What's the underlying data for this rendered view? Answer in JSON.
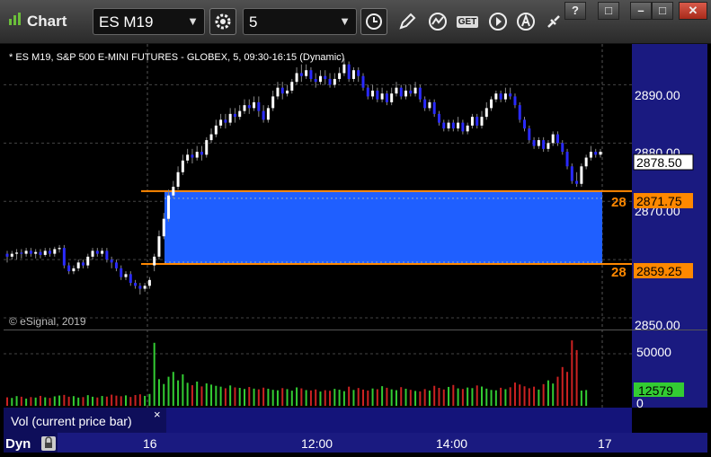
{
  "window": {
    "title": "Chart",
    "help_label": "?",
    "restore_label": "□",
    "minimize_label": "–",
    "maximize_label": "□",
    "close_label": "✕"
  },
  "toolbar": {
    "symbol": "ES M19",
    "interval": "5",
    "get_label": "GET",
    "icons": [
      "settings-gear-icon",
      "clock-icon",
      "pencil-draw-icon",
      "study-chart-icon",
      "get-data-icon",
      "play-icon",
      "alert-a-icon",
      "link-icon"
    ]
  },
  "chart": {
    "header": "* ES M19, S&P 500 E-MINI FUTURES - GLOBEX, 5, 09:30-16:15 (Dynamic)",
    "copyright": "© eSignal, 2019",
    "price_ticks": [
      "2890.00",
      "2880.00",
      "2870.00",
      "2860.00",
      "2850.00"
    ],
    "last_price_label": "2878.50",
    "upper_band_label": "2871.75",
    "lower_band_label": "2859.25",
    "upper_band_text": "28",
    "lower_band_text": "28",
    "volume_ticks": [
      "50000",
      "0"
    ],
    "volume_value_label": "12579",
    "volume_panel_title": "Vol (current price bar)",
    "volume_close": "×",
    "time_ticks": [
      "16",
      "12:00",
      "14:00",
      "17"
    ],
    "dyn_label": "Dyn",
    "colors": {
      "up_candle": "#ffffff",
      "down_candle": "#2a2aff",
      "band_fill": "#1f5fff",
      "band_line": "#ff8800",
      "axis_bg": "#1a1a80",
      "vol_up": "#33cc33",
      "vol_down": "#cc2222"
    }
  },
  "chart_data": {
    "type": "candlestick",
    "ylim": [
      2848,
      2897
    ],
    "band": {
      "upper": 2871.75,
      "lower": 2859.25
    },
    "last": 2878.5,
    "candles": [
      [
        2861.0,
        2860.5,
        2859.5,
        2861.5
      ],
      [
        2860.5,
        2861.0,
        2860.0,
        2861.5
      ],
      [
        2861.0,
        2861.2,
        2860.0,
        2861.8
      ],
      [
        2861.2,
        2861.0,
        2860.2,
        2861.8
      ],
      [
        2861.0,
        2861.5,
        2860.5,
        2862.0
      ],
      [
        2861.5,
        2861.0,
        2860.5,
        2862.0
      ],
      [
        2861.0,
        2861.3,
        2860.2,
        2861.8
      ],
      [
        2861.3,
        2860.8,
        2860.2,
        2861.8
      ],
      [
        2860.8,
        2861.5,
        2860.5,
        2862.0
      ],
      [
        2861.5,
        2861.0,
        2860.5,
        2862.0
      ],
      [
        2861.0,
        2861.8,
        2860.5,
        2862.2
      ],
      [
        2861.8,
        2862.0,
        2861.2,
        2862.5
      ],
      [
        2862.0,
        2859.0,
        2858.5,
        2862.5
      ],
      [
        2859.0,
        2858.0,
        2857.5,
        2859.5
      ],
      [
        2858.0,
        2858.5,
        2857.5,
        2859.0
      ],
      [
        2858.5,
        2859.5,
        2858.0,
        2860.0
      ],
      [
        2859.5,
        2859.0,
        2858.5,
        2860.0
      ],
      [
        2859.0,
        2860.5,
        2858.5,
        2861.0
      ],
      [
        2860.5,
        2861.5,
        2860.0,
        2862.0
      ],
      [
        2861.5,
        2861.0,
        2860.5,
        2862.0
      ],
      [
        2861.0,
        2861.5,
        2860.5,
        2862.0
      ],
      [
        2861.5,
        2860.0,
        2859.5,
        2862.0
      ],
      [
        2860.0,
        2859.5,
        2858.5,
        2860.5
      ],
      [
        2859.5,
        2858.5,
        2858.0,
        2860.0
      ],
      [
        2858.5,
        2857.0,
        2856.5,
        2859.0
      ],
      [
        2857.0,
        2857.5,
        2856.5,
        2858.0
      ],
      [
        2857.5,
        2856.0,
        2855.5,
        2858.0
      ],
      [
        2856.0,
        2855.5,
        2855.0,
        2856.5
      ],
      [
        2855.5,
        2855.0,
        2854.0,
        2856.0
      ],
      [
        2855.0,
        2855.5,
        2854.5,
        2856.0
      ],
      [
        2855.5,
        2856.5,
        2855.0,
        2857.0
      ],
      [
        2859.0,
        2860.5,
        2858.0,
        2861.0
      ],
      [
        2860.5,
        2864.0,
        2860.0,
        2865.0
      ],
      [
        2864.0,
        2867.0,
        2863.5,
        2868.0
      ],
      [
        2867.0,
        2871.0,
        2866.5,
        2872.0
      ],
      [
        2871.0,
        2872.5,
        2870.5,
        2873.5
      ],
      [
        2872.5,
        2875.0,
        2872.0,
        2876.0
      ],
      [
        2875.0,
        2877.0,
        2874.5,
        2878.0
      ],
      [
        2877.0,
        2878.0,
        2876.5,
        2879.0
      ],
      [
        2878.0,
        2877.5,
        2876.5,
        2879.0
      ],
      [
        2877.5,
        2878.5,
        2877.0,
        2879.5
      ],
      [
        2878.5,
        2878.0,
        2877.0,
        2879.5
      ],
      [
        2878.0,
        2880.5,
        2877.5,
        2881.0
      ],
      [
        2880.5,
        2881.5,
        2880.0,
        2882.5
      ],
      [
        2881.5,
        2883.0,
        2881.0,
        2884.0
      ],
      [
        2883.0,
        2884.0,
        2882.5,
        2885.0
      ],
      [
        2884.0,
        2883.5,
        2882.5,
        2885.0
      ],
      [
        2883.5,
        2885.0,
        2883.0,
        2886.0
      ],
      [
        2885.0,
        2884.5,
        2883.5,
        2886.0
      ],
      [
        2884.5,
        2885.5,
        2884.0,
        2886.5
      ],
      [
        2885.5,
        2886.5,
        2885.0,
        2887.5
      ],
      [
        2886.5,
        2886.0,
        2885.0,
        2887.5
      ],
      [
        2886.0,
        2887.0,
        2885.5,
        2888.0
      ],
      [
        2887.0,
        2885.5,
        2884.5,
        2888.0
      ],
      [
        2885.5,
        2884.0,
        2883.5,
        2886.5
      ],
      [
        2884.0,
        2886.0,
        2883.5,
        2886.5
      ],
      [
        2886.0,
        2888.0,
        2885.5,
        2889.0
      ],
      [
        2888.0,
        2889.5,
        2887.5,
        2890.5
      ],
      [
        2889.5,
        2888.5,
        2887.5,
        2890.5
      ],
      [
        2888.5,
        2889.0,
        2888.0,
        2890.0
      ],
      [
        2889.0,
        2890.5,
        2888.5,
        2891.0
      ],
      [
        2890.5,
        2892.0,
        2890.0,
        2893.0
      ],
      [
        2892.0,
        2891.5,
        2890.5,
        2893.5
      ],
      [
        2891.5,
        2892.5,
        2891.0,
        2893.5
      ],
      [
        2892.5,
        2891.0,
        2890.5,
        2893.0
      ],
      [
        2891.0,
        2890.5,
        2889.5,
        2892.0
      ],
      [
        2890.5,
        2891.5,
        2890.0,
        2892.5
      ],
      [
        2891.5,
        2891.0,
        2890.0,
        2892.5
      ],
      [
        2891.0,
        2890.0,
        2889.5,
        2892.0
      ],
      [
        2890.0,
        2891.0,
        2889.5,
        2892.0
      ],
      [
        2891.0,
        2892.0,
        2890.5,
        2893.0
      ],
      [
        2892.0,
        2893.5,
        2891.5,
        2894.5
      ],
      [
        2893.5,
        2891.0,
        2890.5,
        2894.0
      ],
      [
        2891.0,
        2892.5,
        2890.5,
        2893.0
      ],
      [
        2892.5,
        2891.5,
        2890.5,
        2893.0
      ],
      [
        2891.5,
        2889.5,
        2889.0,
        2892.0
      ],
      [
        2889.5,
        2888.0,
        2887.5,
        2890.0
      ],
      [
        2888.0,
        2889.0,
        2887.5,
        2890.0
      ],
      [
        2889.0,
        2887.5,
        2887.0,
        2889.5
      ],
      [
        2887.5,
        2888.5,
        2887.0,
        2889.5
      ],
      [
        2888.5,
        2887.0,
        2886.5,
        2889.0
      ],
      [
        2887.0,
        2888.5,
        2886.5,
        2889.5
      ],
      [
        2888.5,
        2889.5,
        2888.0,
        2890.5
      ],
      [
        2889.5,
        2888.0,
        2887.5,
        2890.0
      ],
      [
        2888.0,
        2889.0,
        2887.5,
        2890.0
      ],
      [
        2889.0,
        2888.5,
        2888.0,
        2890.0
      ],
      [
        2888.5,
        2889.5,
        2888.0,
        2890.5
      ],
      [
        2889.5,
        2887.5,
        2887.0,
        2890.0
      ],
      [
        2887.5,
        2886.0,
        2885.5,
        2888.0
      ],
      [
        2886.0,
        2887.0,
        2885.5,
        2887.5
      ],
      [
        2887.0,
        2885.0,
        2884.5,
        2887.5
      ],
      [
        2885.0,
        2883.5,
        2883.0,
        2885.5
      ],
      [
        2883.5,
        2882.5,
        2882.0,
        2884.0
      ],
      [
        2882.5,
        2883.5,
        2882.0,
        2884.0
      ],
      [
        2883.5,
        2882.5,
        2882.0,
        2884.0
      ],
      [
        2882.5,
        2883.5,
        2882.0,
        2884.5
      ],
      [
        2883.5,
        2882.0,
        2881.5,
        2884.0
      ],
      [
        2882.0,
        2883.0,
        2881.5,
        2883.5
      ],
      [
        2883.0,
        2884.5,
        2882.5,
        2885.0
      ],
      [
        2884.5,
        2883.0,
        2882.5,
        2885.0
      ],
      [
        2883.0,
        2884.5,
        2882.5,
        2885.5
      ],
      [
        2884.5,
        2886.0,
        2884.0,
        2887.0
      ],
      [
        2886.0,
        2887.5,
        2885.5,
        2888.0
      ],
      [
        2887.5,
        2888.5,
        2887.0,
        2889.0
      ],
      [
        2888.5,
        2887.5,
        2887.0,
        2889.0
      ],
      [
        2887.5,
        2888.5,
        2887.0,
        2889.5
      ],
      [
        2888.5,
        2888.0,
        2887.5,
        2889.5
      ],
      [
        2888.0,
        2886.5,
        2886.0,
        2888.5
      ],
      [
        2886.5,
        2884.0,
        2883.5,
        2887.0
      ],
      [
        2884.0,
        2882.5,
        2882.0,
        2884.5
      ],
      [
        2882.5,
        2880.5,
        2880.0,
        2883.0
      ],
      [
        2880.5,
        2879.5,
        2879.0,
        2881.0
      ],
      [
        2879.5,
        2880.5,
        2879.0,
        2881.0
      ],
      [
        2880.5,
        2879.0,
        2878.5,
        2881.0
      ],
      [
        2879.0,
        2880.0,
        2878.5,
        2880.5
      ],
      [
        2880.0,
        2881.5,
        2879.5,
        2882.0
      ],
      [
        2881.5,
        2880.0,
        2879.5,
        2882.0
      ],
      [
        2880.0,
        2878.5,
        2878.0,
        2880.5
      ],
      [
        2878.5,
        2876.0,
        2875.5,
        2879.0
      ],
      [
        2876.0,
        2873.5,
        2873.0,
        2876.5
      ],
      [
        2873.5,
        2873.0,
        2872.5,
        2875.0
      ],
      [
        2873.0,
        2876.0,
        2872.5,
        2876.5
      ],
      [
        2876.0,
        2877.5,
        2875.5,
        2878.0
      ],
      [
        2877.5,
        2878.5,
        2877.0,
        2879.5
      ],
      [
        2878.5,
        2878.0,
        2877.5,
        2879.0
      ],
      [
        2878.0,
        2878.5,
        2877.5,
        2879.0
      ]
    ],
    "volume": [
      7000,
      6500,
      8000,
      7500,
      6000,
      7200,
      6800,
      8200,
      7000,
      6500,
      7800,
      8500,
      9000,
      7500,
      8000,
      6800,
      7200,
      8800,
      7500,
      6900,
      8100,
      7600,
      9200,
      8400,
      7900,
      8600,
      7300,
      8900,
      9500,
      8200,
      9800,
      52000,
      22000,
      18000,
      24000,
      28000,
      21000,
      26000,
      19000,
      17000,
      20000,
      16000,
      18500,
      17500,
      16500,
      15800,
      14500,
      16800,
      15200,
      14800,
      13900,
      15500,
      14200,
      13600,
      15000,
      14100,
      13200,
      12800,
      14600,
      13800,
      12500,
      15200,
      14400,
      13000,
      12700,
      13500,
      11800,
      12900,
      12400,
      14000,
      13300,
      12100,
      15800,
      13100,
      14700,
      13400,
      12600,
      14300,
      13700,
      16200,
      14900,
      13600,
      12900,
      15400,
      14100,
      13200,
      12300,
      11900,
      13800,
      12600,
      16500,
      14800,
      13500,
      15600,
      17200,
      14400,
      13900,
      15100,
      14600,
      16800,
      15900,
      14200,
      13100,
      12800,
      14900,
      13700,
      15300,
      19200,
      17600,
      16100,
      14500,
      15800,
      13400,
      17900,
      21000,
      18400,
      24000,
      32000,
      28000,
      54000,
      46000,
      12579,
      13000
    ],
    "volume_ylim": [
      0,
      60000
    ]
  }
}
